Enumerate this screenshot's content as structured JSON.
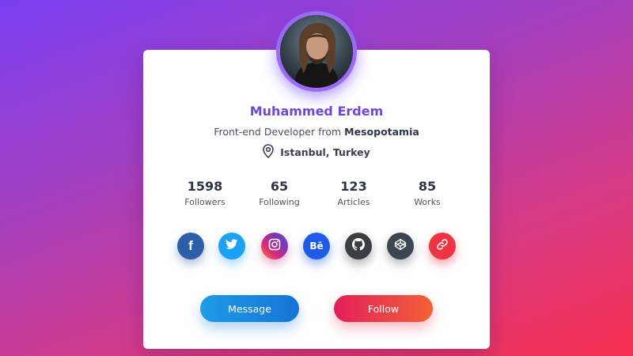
{
  "profile": {
    "name": "Muhammed Erdem",
    "bio_prefix": "Front-end Developer from ",
    "bio_place": "Mesopotamia",
    "location": "Istanbul, Turkey"
  },
  "stats": [
    {
      "value": "1598",
      "label": "Followers"
    },
    {
      "value": "65",
      "label": "Following"
    },
    {
      "value": "123",
      "label": "Articles"
    },
    {
      "value": "85",
      "label": "Works"
    }
  ],
  "socials": [
    {
      "icon": "facebook-icon",
      "glyph": "f",
      "color": "#2d5fa8"
    },
    {
      "icon": "twitter-icon",
      "glyph": "",
      "color": "#1da1f2"
    },
    {
      "icon": "instagram-icon",
      "glyph": "",
      "color": "#c13584"
    },
    {
      "icon": "behance-icon",
      "glyph": "Bē",
      "color": "#1f5ae8"
    },
    {
      "icon": "github-icon",
      "glyph": "",
      "color": "#3a3d42"
    },
    {
      "icon": "codepen-icon",
      "glyph": "",
      "color": "#3c4652"
    },
    {
      "icon": "link-icon",
      "glyph": "",
      "color": "#ee3344"
    }
  ],
  "buttons": {
    "message": "Message",
    "follow": "Follow"
  },
  "colors": {
    "accent": "#7246d8",
    "background_start": "#7b3ff2",
    "background_end": "#f8304f"
  }
}
